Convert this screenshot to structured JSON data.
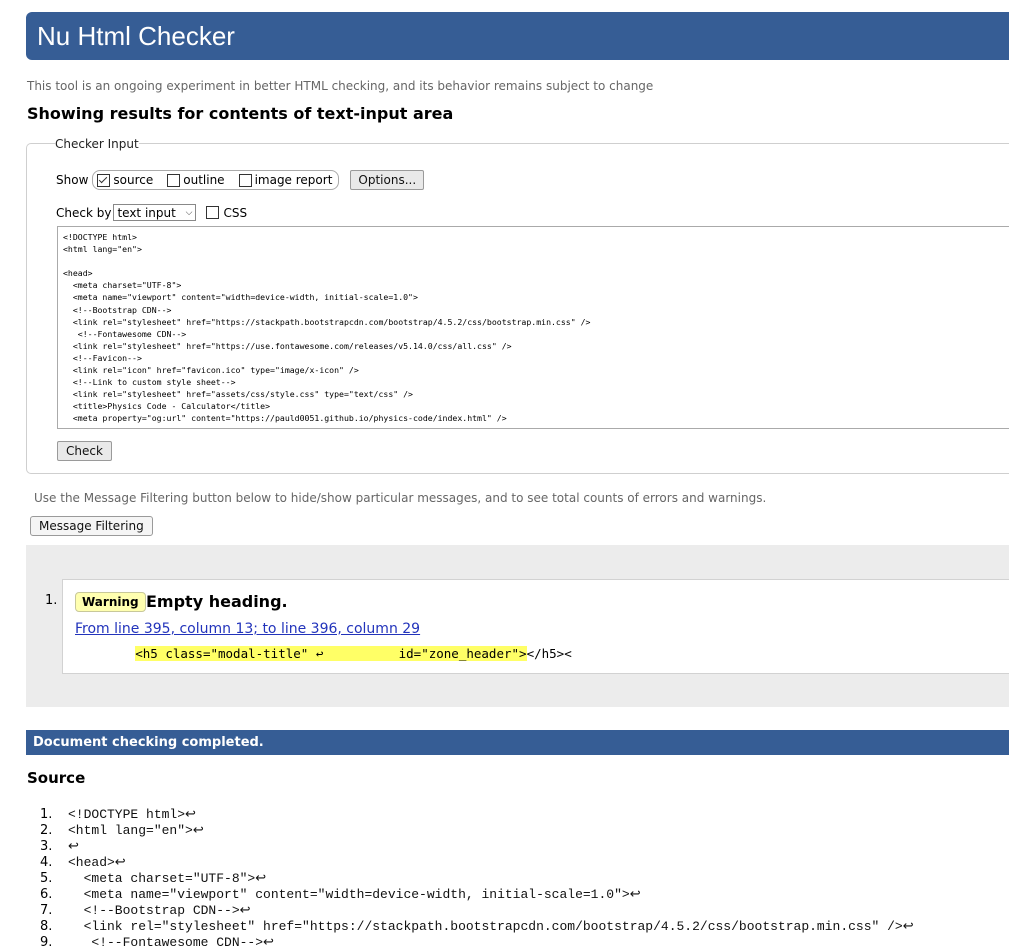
{
  "app": {
    "title": "Nu Html Checker"
  },
  "tagline": "This tool is an ongoing experiment in better HTML checking, and its behavior remains subject to change",
  "results_heading": "Showing results for contents of text-input area",
  "checker_input": {
    "legend": "Checker Input",
    "show_label": "Show",
    "options": [
      {
        "label": "source",
        "checked": true
      },
      {
        "label": "outline",
        "checked": false
      },
      {
        "label": "image report",
        "checked": false
      }
    ],
    "options_button": "Options...",
    "check_by_label": "Check by",
    "check_by_value": "text input",
    "css_label": "CSS",
    "css_checked": false,
    "textarea_content": "<!DOCTYPE html>\n<html lang=\"en\">\n\n<head>\n  <meta charset=\"UTF-8\">\n  <meta name=\"viewport\" content=\"width=device-width, initial-scale=1.0\">\n  <!--Bootstrap CDN-->\n  <link rel=\"stylesheet\" href=\"https://stackpath.bootstrapcdn.com/bootstrap/4.5.2/css/bootstrap.min.css\" />\n   <!--Fontawesome CDN-->\n  <link rel=\"stylesheet\" href=\"https://use.fontawesome.com/releases/v5.14.0/css/all.css\" />\n  <!--Favicon-->\n  <link rel=\"icon\" href=\"favicon.ico\" type=\"image/x-icon\" />\n  <!--Link to custom style sheet-->\n  <link rel=\"stylesheet\" href=\"assets/css/style.css\" type=\"text/css\" />\n  <title>Physics Code - Calculator</title>\n  <meta property=\"og:url\" content=\"https://pauld0051.github.io/physics-code/index.html\" />\n  <meta property=\"og:type\" content=\"website\" />",
    "check_button": "Check"
  },
  "filter_note": "Use the Message Filtering button below to hide/show particular messages, and to see total counts of errors and warnings.",
  "filter_button": "Message Filtering",
  "messages": [
    {
      "number": "1.",
      "type": "Warning",
      "title": "Empty heading.",
      "location": "From line 395, column 13; to line 396, column 29",
      "extract_pre": "        ",
      "extract_hl": "<h5 class=\"modal-title\" ↩          id=\"zone_header\">",
      "extract_post": "</h5><"
    }
  ],
  "completed_banner": "Document checking completed.",
  "source_heading": "Source",
  "source_lines": [
    {
      "n": "1.",
      "code": "<!DOCTYPE html>↩"
    },
    {
      "n": "2.",
      "code": "<html lang=\"en\">↩"
    },
    {
      "n": "3.",
      "code": "↩"
    },
    {
      "n": "4.",
      "code": "<head>↩"
    },
    {
      "n": "5.",
      "code": "  <meta charset=\"UTF-8\">↩"
    },
    {
      "n": "6.",
      "code": "  <meta name=\"viewport\" content=\"width=device-width, initial-scale=1.0\">↩"
    },
    {
      "n": "7.",
      "code": "  <!--Bootstrap CDN-->↩"
    },
    {
      "n": "8.",
      "code": "  <link rel=\"stylesheet\" href=\"https://stackpath.bootstrapcdn.com/bootstrap/4.5.2/css/bootstrap.min.css\" />↩"
    },
    {
      "n": "9.",
      "code": "   <!--Fontawesome CDN-->↩"
    }
  ],
  "colors": {
    "brand": "#365d95",
    "warning_bg": "#ffffb0",
    "highlight": "#ffff66",
    "link": "#2233bb"
  }
}
